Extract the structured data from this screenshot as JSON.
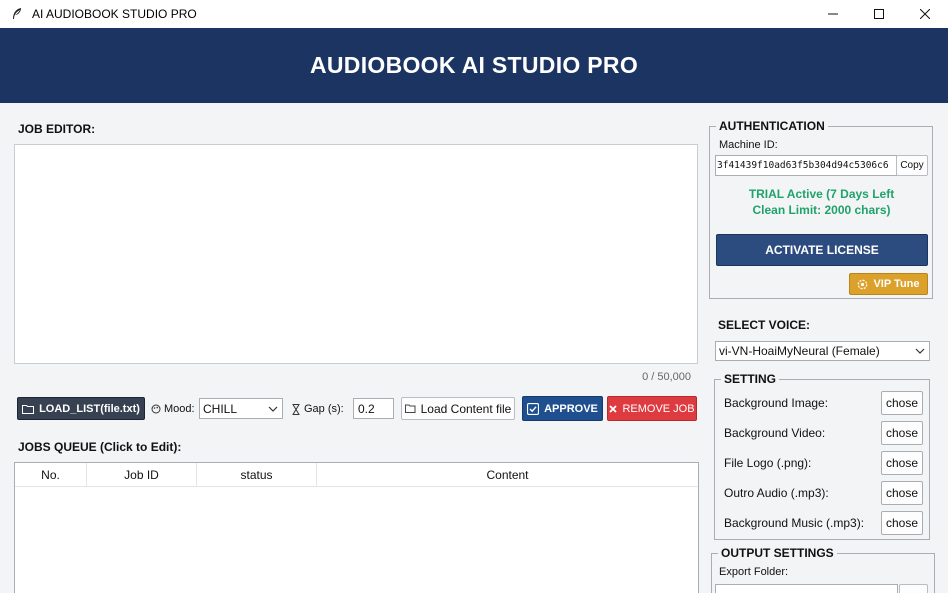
{
  "window": {
    "title": "AI AUDIOBOOK STUDIO PRO"
  },
  "banner": {
    "title": "AUDIOBOOK AI STUDIO PRO"
  },
  "editor": {
    "label": "JOB EDITOR:",
    "content": "",
    "char_count": "0 / 50,000"
  },
  "toolbar": {
    "load_list_label": "LOAD_LIST(file.txt)",
    "mood_label": "Mood:",
    "mood_value": "CHILL",
    "gap_label": "Gap (s):",
    "gap_value": "0.2",
    "load_content_label": "Load Content file",
    "approve_label": "APPROVE",
    "remove_label": "REMOVE JOB"
  },
  "queue": {
    "label": "JOBS QUEUE (Click to Edit):",
    "columns": [
      "No.",
      "Job ID",
      "status",
      "Content"
    ],
    "rows": []
  },
  "auth": {
    "title": "AUTHENTICATION",
    "machine_id_label": "Machine ID:",
    "machine_id": "3f41439f10ad63f5b304d94c5306c6",
    "copy_label": "Copy",
    "trial_line1": "TRIAL Active (7 Days Left",
    "trial_line2": "Clean Limit: 2000 chars)",
    "activate_label": "ACTIVATE LICENSE",
    "vip_label": "VIP Tune"
  },
  "voice": {
    "label": "SELECT VOICE:",
    "selected": "vi-VN-HoaiMyNeural (Female)"
  },
  "setting": {
    "title": "SETTING",
    "rows": [
      {
        "label": "Background Image:",
        "button": "chose"
      },
      {
        "label": "Background Video:",
        "button": "chose"
      },
      {
        "label": "File Logo (.png):",
        "button": "chose"
      },
      {
        "label": "Outro Audio (.mp3):",
        "button": "chose"
      },
      {
        "label": "Background Music (.mp3):",
        "button": "chose"
      }
    ]
  },
  "output": {
    "title": "OUTPUT SETTINGS",
    "export_folder_label": "Export Folder:"
  },
  "colors": {
    "banner": "#1b3461",
    "approve": "#1f4f8f",
    "remove": "#dd3b3f",
    "trial": "#1fa36b",
    "vip": "#dba12a"
  }
}
